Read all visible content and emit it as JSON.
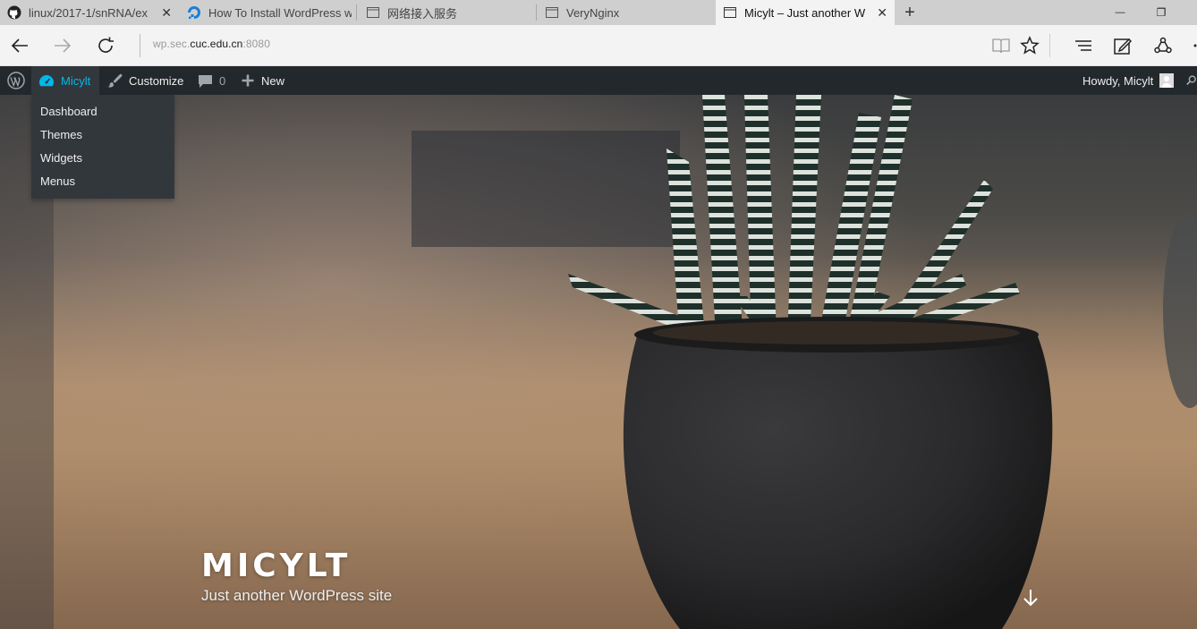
{
  "browser": {
    "tabs": [
      {
        "title": "linux/2017-1/snRNA/ex",
        "icon": "github-icon",
        "active": false,
        "close": "✕"
      },
      {
        "title": "How To Install WordPress w",
        "icon": "digitalocean-icon",
        "active": false,
        "close": ""
      },
      {
        "title": "网络接入服务",
        "icon": "page-icon",
        "active": false,
        "close": ""
      },
      {
        "title": "VeryNginx",
        "icon": "page-icon",
        "active": false,
        "close": ""
      },
      {
        "title": "Micylt – Just another W",
        "icon": "page-icon",
        "active": true,
        "close": "✕"
      }
    ],
    "new_tab": "+",
    "window_controls": {
      "minimize": "—",
      "restore": "❐"
    },
    "address": {
      "prefix": "wp.sec.",
      "host": "cuc.edu.cn",
      "port": ":8080"
    }
  },
  "adminbar": {
    "site_name": "Micylt",
    "customize": "Customize",
    "comments_count": "0",
    "new_label": "New",
    "howdy": "Howdy, Micylt",
    "menu": [
      "Dashboard",
      "Themes",
      "Widgets",
      "Menus"
    ]
  },
  "hero": {
    "site_title": "MICYLT",
    "tagline": "Just another WordPress site"
  },
  "colors": {
    "adminbar_bg": "#23282d",
    "adminbar_hover": "#32373c",
    "accent": "#00b9eb"
  }
}
